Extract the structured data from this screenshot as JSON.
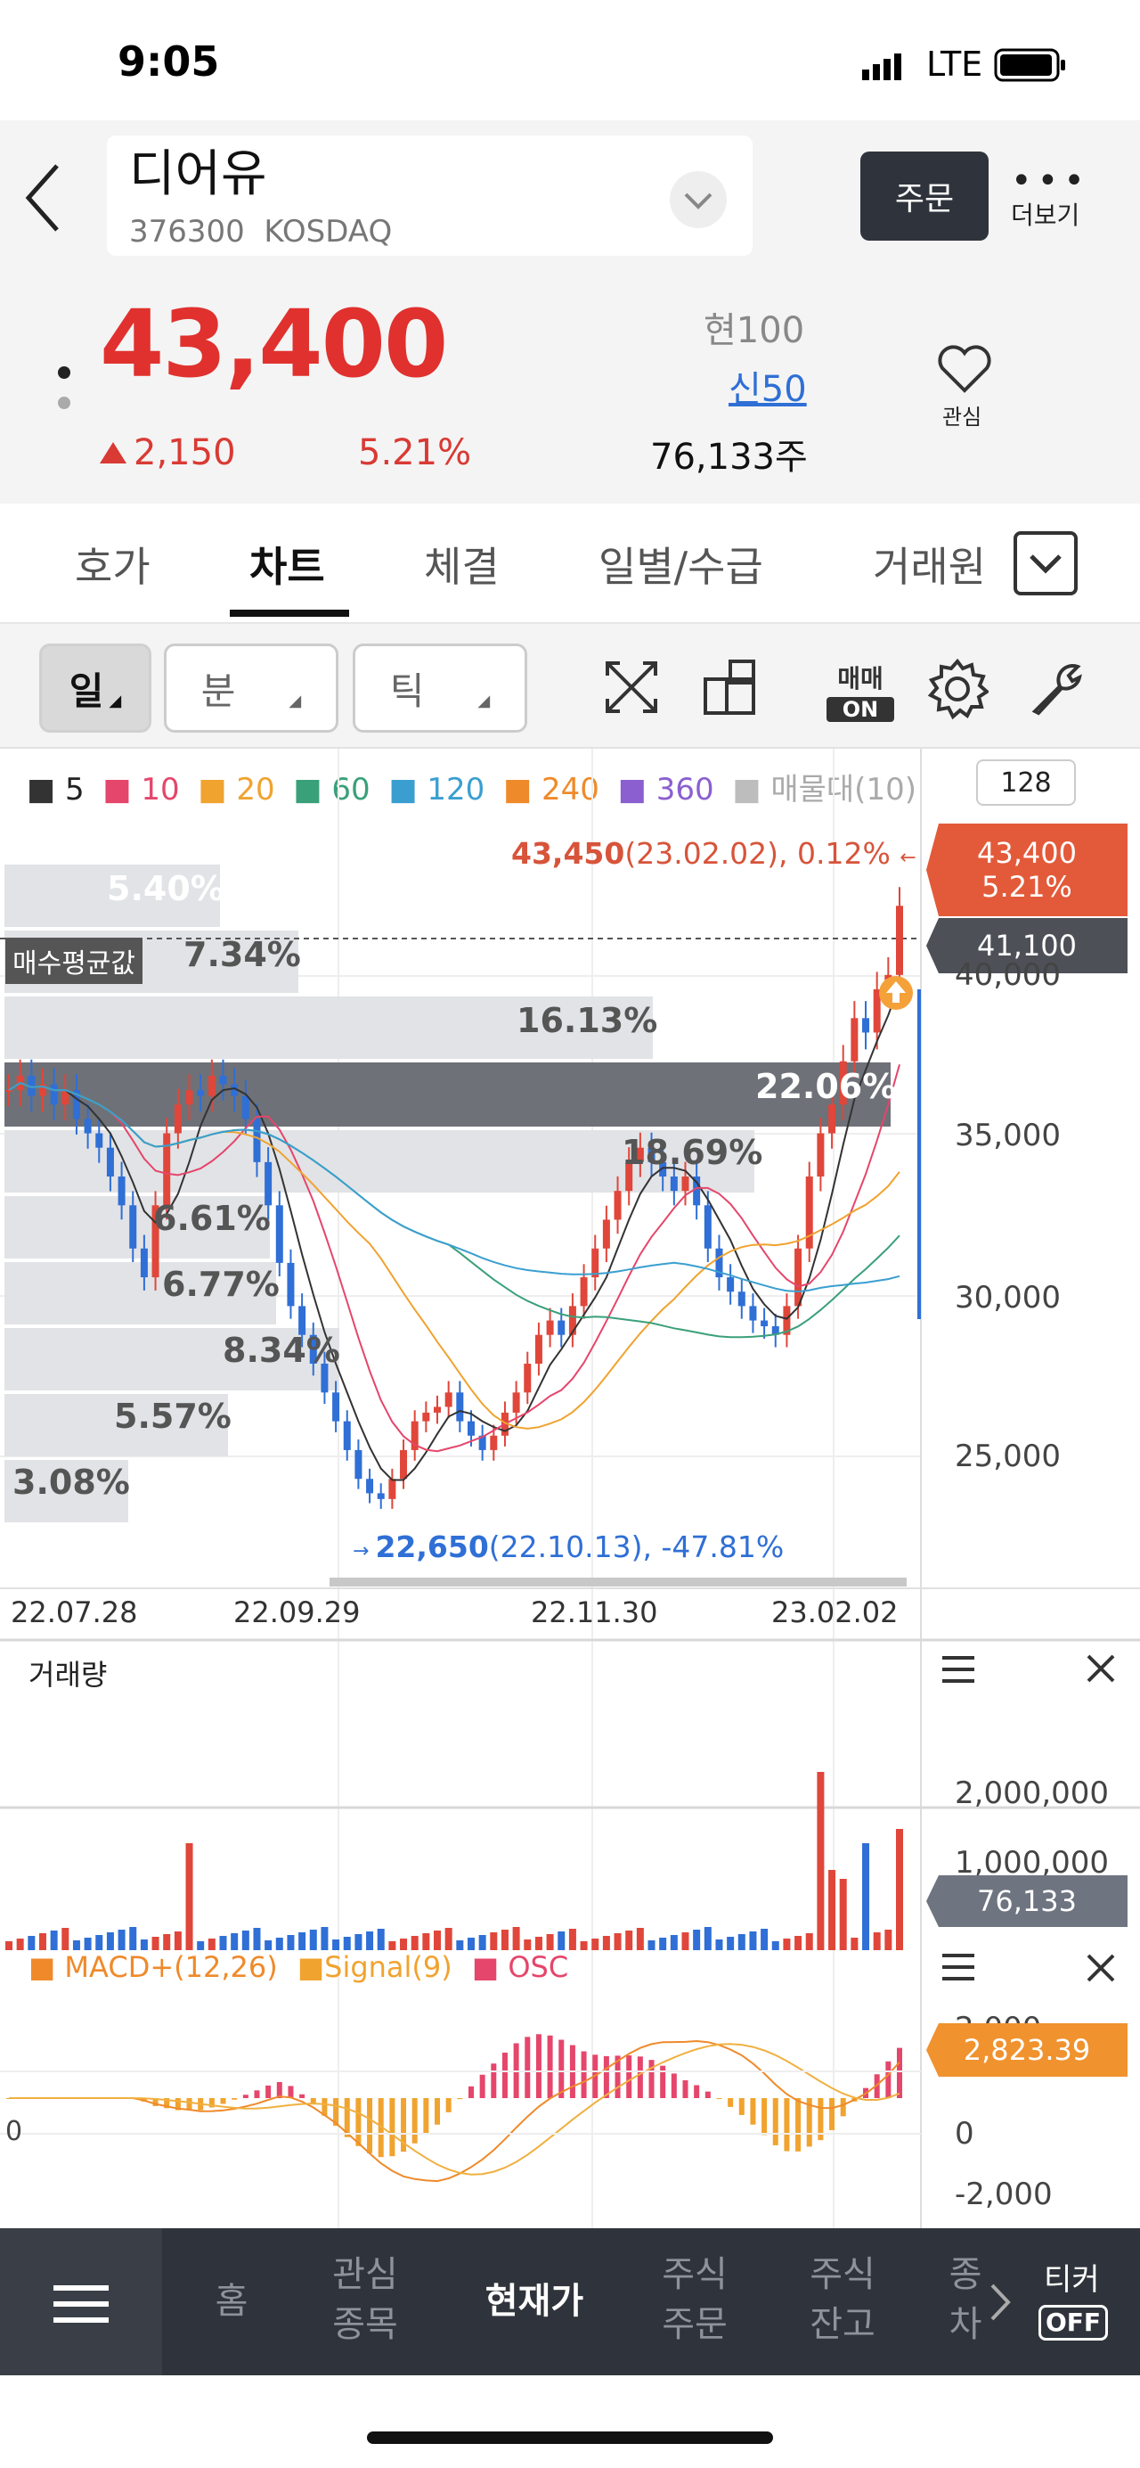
{
  "status": {
    "time": "9:05",
    "network": "LTE"
  },
  "stock": {
    "name": "디어유",
    "code": "376300",
    "market": "KOSDAQ",
    "price": "43,400",
    "change": "2,150",
    "change_pct": "5.21%",
    "hyun": "현100",
    "shin": "신50",
    "volume": "76,133주"
  },
  "header": {
    "order_label": "주문",
    "more_label": "더보기",
    "watch_label": "관심"
  },
  "tabs": [
    {
      "label": "호가"
    },
    {
      "label": "차트"
    },
    {
      "label": "체결"
    },
    {
      "label": "일별/수급"
    },
    {
      "label": "거래원"
    }
  ],
  "toolbar": {
    "day": "일",
    "minute": "분",
    "tick": "틱",
    "trade_top": "매매",
    "trade_on": "ON"
  },
  "chart": {
    "legend": [
      {
        "label": "5",
        "color": "#333333"
      },
      {
        "label": "10",
        "color": "#e5466b"
      },
      {
        "label": "20",
        "color": "#f0a32f"
      },
      {
        "label": "60",
        "color": "#3aa07a"
      },
      {
        "label": "120",
        "color": "#3a9fd0"
      },
      {
        "label": "240",
        "color": "#ef8a2b"
      },
      {
        "label": "360",
        "color": "#8b5fd0"
      },
      {
        "label": "매물대(10)",
        "color": "#bdbdbd"
      }
    ],
    "period_count": "128",
    "high_note_value": "43,450",
    "high_note_rest": "(23.02.02), 0.12%",
    "low_note_value": "22,650",
    "low_note_rest": "(22.10.13), -47.81%",
    "avg_label": "매수평균값",
    "price_tag_1": "43,400",
    "price_tag_2": "5.21%",
    "avg_tag": "41,100",
    "volume_profile": [
      "5.40%",
      "7.34%",
      "16.13%",
      "22.06%",
      "18.69%",
      "6.61%",
      "6.77%",
      "8.34%",
      "5.57%",
      "3.08%"
    ],
    "yticks": [
      "40,000",
      "35,000",
      "30,000",
      "25,000"
    ],
    "xticks": [
      "22.07.28",
      "22.09.29",
      "22.11.30",
      "23.02.02"
    ]
  },
  "volume_panel": {
    "title": "거래량",
    "yticks": [
      "2,000,000",
      "1,000,000"
    ],
    "tag": "76,133"
  },
  "macd_panel": {
    "legend_macd": "MACD+(12,26)",
    "legend_signal": "Signal(9)",
    "legend_osc": "OSC",
    "yticks": [
      "2,000",
      "0",
      "-2,000"
    ],
    "tag": "2,823.39",
    "zero_label": "0"
  },
  "nav": {
    "items": [
      {
        "line1": "홈",
        "line2": ""
      },
      {
        "line1": "관심",
        "line2": "종목"
      },
      {
        "line1": "현재가",
        "line2": ""
      },
      {
        "line1": "주식",
        "line2": "주문"
      },
      {
        "line1": "주식",
        "line2": "잔고"
      },
      {
        "line1": "종",
        "line2": "차"
      }
    ],
    "ticker_label": "티커",
    "ticker_state": "OFF"
  },
  "chart_data": {
    "type": "candlestick",
    "x_ticks": [
      "22.07.28",
      "22.09.29",
      "22.11.30",
      "23.02.02"
    ],
    "y_range": [
      21000,
      47000
    ],
    "closes": [
      37000,
      37500,
      36800,
      37200,
      36500,
      37000,
      36000,
      35500,
      35000,
      34000,
      33000,
      31500,
      30500,
      33000,
      35500,
      36500,
      37000,
      36800,
      37500,
      37200,
      36800,
      36000,
      34500,
      33000,
      31000,
      29500,
      28500,
      27500,
      26500,
      25500,
      24500,
      23500,
      23000,
      22800,
      23500,
      24500,
      25500,
      25800,
      26000,
      26500,
      25500,
      25000,
      24500,
      25000,
      25800,
      26500,
      27500,
      28500,
      29000,
      28500,
      29500,
      30500,
      31500,
      32500,
      33500,
      34500,
      35000,
      34500,
      34000,
      33500,
      34000,
      33000,
      31500,
      30500,
      30000,
      29500,
      29000,
      28800,
      28500,
      29500,
      31500,
      34000,
      35500,
      36500,
      38000,
      39500,
      39000,
      40500,
      41000,
      43400
    ],
    "series_ma5_color": "#333333",
    "volume_profile_pct": [
      5.4,
      7.34,
      16.13,
      22.06,
      18.69,
      6.61,
      6.77,
      8.34,
      5.57,
      3.08
    ]
  }
}
